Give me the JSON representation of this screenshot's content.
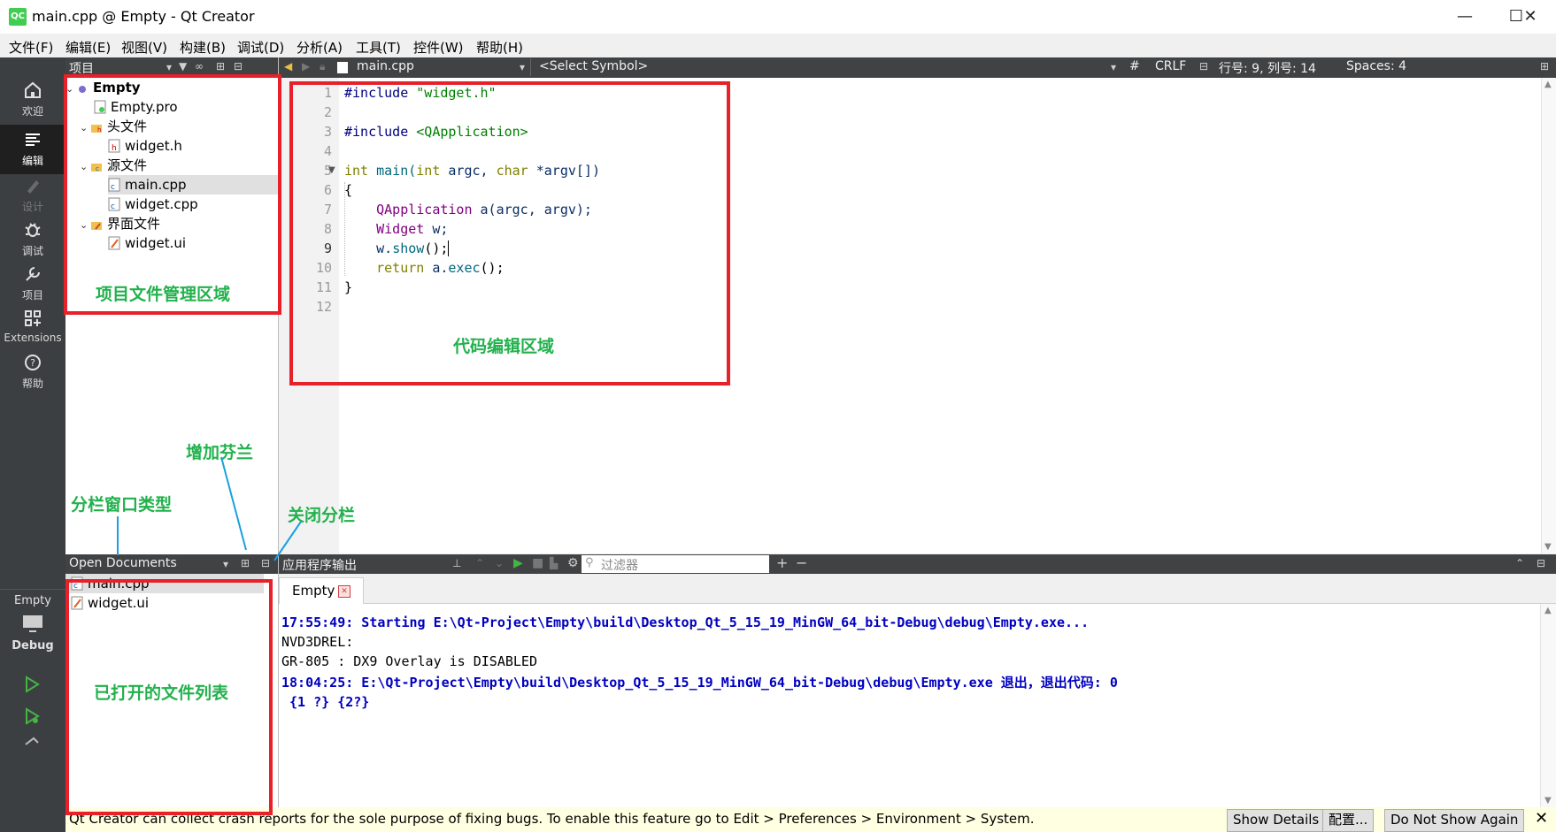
{
  "window": {
    "title": "main.cpp @ Empty - Qt Creator",
    "logo": "QC",
    "controls": [
      "minimize-icon",
      "maximize-icon",
      "close-icon"
    ]
  },
  "menu": [
    "文件(F)",
    "编辑(E)",
    "视图(V)",
    "构建(B)",
    "调试(D)",
    "分析(A)",
    "工具(T)",
    "控件(W)",
    "帮助(H)"
  ],
  "modes": [
    {
      "label": "欢迎",
      "icon": "home-icon"
    },
    {
      "label": "编辑",
      "icon": "edit-lines-icon"
    },
    {
      "label": "设计",
      "icon": "pen-icon"
    },
    {
      "label": "调试",
      "icon": "bug-icon"
    },
    {
      "label": "项目",
      "icon": "wrench-icon"
    },
    {
      "label": "Extensions",
      "icon": "extensions-icon"
    },
    {
      "label": "帮助",
      "icon": "help-icon"
    }
  ],
  "kit": {
    "project": "Empty",
    "config": "Debug"
  },
  "project_panel": {
    "title": "项目",
    "tree": [
      {
        "label": "Empty",
        "bold": true
      },
      {
        "label": "Empty.pro"
      },
      {
        "label": "头文件"
      },
      {
        "label": "widget.h"
      },
      {
        "label": "源文件"
      },
      {
        "label": "main.cpp",
        "selected": true
      },
      {
        "label": "widget.cpp"
      },
      {
        "label": "界面文件"
      },
      {
        "label": "widget.ui"
      }
    ]
  },
  "editor": {
    "file": "main.cpp",
    "symbol": "<Select Symbol>",
    "hash": "#",
    "line_ending": "CRLF",
    "position": "行号: 9, 列号: 14",
    "indent": "Spaces: 4",
    "line_numbers": [
      "1",
      "2",
      "3",
      "4",
      "5",
      "6",
      "7",
      "8",
      "9",
      "10",
      "11",
      "12"
    ],
    "current_line": "9",
    "code": {
      "l1a": "#include ",
      "l1b": "\"widget.h\"",
      "l3a": "#include ",
      "l3b": "<QApplication>",
      "l5a": "int",
      "l5b": " main(",
      "l5c": "int",
      "l5d": " argc, ",
      "l5e": "char",
      "l5f": " *argv[])",
      "l6": "{",
      "l7a": "    QApplication",
      "l7b": " a(argc, argv);",
      "l8a": "    Widget",
      "l8b": " w;",
      "l9a": "    w.",
      "l9b": "show",
      "l9c": "();",
      "l10a": "    return",
      "l10b": " a.",
      "l10c": "exec",
      "l10d": "();",
      "l11": "}"
    }
  },
  "open_documents": {
    "title": "Open Documents",
    "items": [
      "main.cpp",
      "widget.ui"
    ]
  },
  "output_panel": {
    "title": "应用程序输出",
    "filter_placeholder": "过滤器",
    "tab": "Empty",
    "lines": [
      "17:55:49: Starting E:\\Qt-Project\\Empty\\build\\Desktop_Qt_5_15_19_MinGW_64_bit-Debug\\debug\\Empty.exe...",
      "NVD3DREL:",
      "GR-805 : DX9 Overlay is DISABLED",
      "18:04:25: E:\\Qt-Project\\Empty\\build\\Desktop_Qt_5_15_19_MinGW_64_bit-Debug\\debug\\Empty.exe 退出，退出代码: 0",
      " {1 ?} {2?}"
    ]
  },
  "infobar": {
    "message": "Qt Creator can collect crash reports for the sole purpose of fixing bugs. To enable this feature go to Edit > Preferences > Environment > System.",
    "buttons": [
      "Show Details",
      "配置...",
      "Do Not Show Again"
    ]
  },
  "annotations": {
    "project_area": "项目文件管理区域",
    "code_area": "代码编辑区域",
    "add_split": "增加芬兰",
    "split_type": "分栏窗口类型",
    "close_split": "关闭分栏",
    "open_files": "已打开的文件列表"
  },
  "colors": {
    "annotation_green": "#22b14c",
    "annotation_red": "#e8202a",
    "mode_bar": "#3c3f41",
    "output_blue": "#0000c0"
  }
}
